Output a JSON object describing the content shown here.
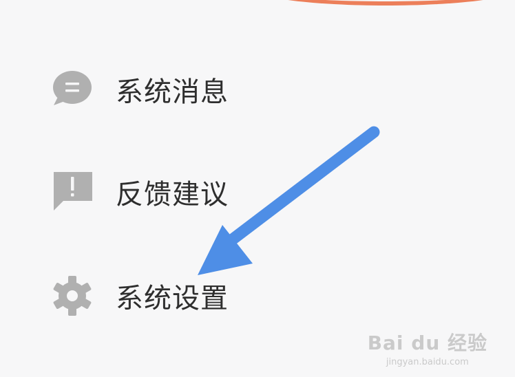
{
  "menu": {
    "items": [
      {
        "label": "系统消息",
        "icon": "chat-bubble-icon"
      },
      {
        "label": "反馈建议",
        "icon": "feedback-exclamation-icon"
      },
      {
        "label": "系统设置",
        "icon": "gear-icon"
      }
    ]
  },
  "annotation": {
    "arrow_color": "#4e8ee6",
    "points_to": "系统设置"
  },
  "colors": {
    "background": "#f7f7f8",
    "icon": "#b0b0b0",
    "text": "#2e2e2e",
    "top_accent": "#ec7f5a"
  },
  "watermark": {
    "logo_text": "Bai du 经验",
    "url": "jingyan.baidu.com"
  }
}
